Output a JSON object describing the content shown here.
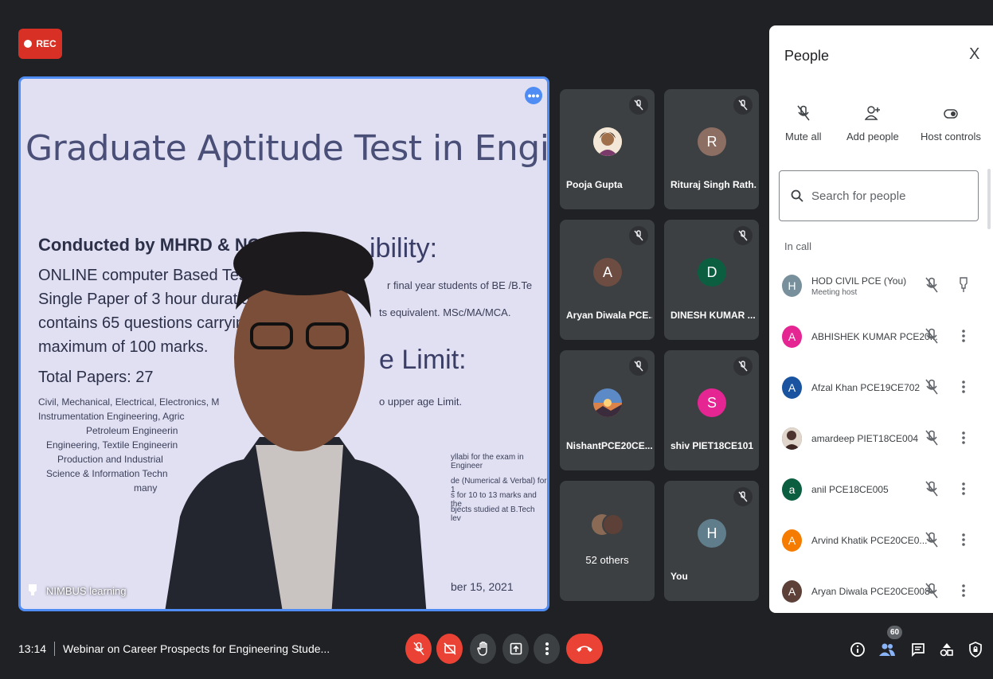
{
  "recording": {
    "label": "REC"
  },
  "slide": {
    "title": "Graduate Aptitude Test in Engineering",
    "heading": "Conducted by MHRD & NCB.",
    "lines": [
      "ONLINE computer Based Test (CBT)",
      "Single Paper of 3 hour duration that",
      "contains 65 questions carrying a",
      "maximum of 100 marks."
    ],
    "total_papers": "Total Papers: 27",
    "small_lines": [
      "Civil, Mechanical, Electrical, Electronics, M",
      "Instrumentation Engineering, Agric",
      "Petroleum Engineerin",
      "Engineering, Textile Engineerin",
      "Production and Industrial",
      "Science & Information Techn",
      "many"
    ],
    "right_heading_1": "ibility:",
    "right_text_1": "r final year students of BE /B.Te",
    "right_text_2": "ts equivalent. MSc/MA/MCA.",
    "right_heading_2": "e Limit:",
    "right_text_3": "o upper age Limit.",
    "right_small": [
      "yllabi for the exam in Engineer",
      "de (Numerical & Verbal) for 1",
      "s for 10 to 13 marks and the",
      "bjects studied at B.Tech lev"
    ],
    "date_fragment": "ber 15, 2021"
  },
  "main_tile": {
    "name": "NIMBUS learning",
    "more_glyph": "•••"
  },
  "tiles": [
    {
      "name": "Pooja Gupta",
      "initial": "",
      "color": "#f0c080"
    },
    {
      "name": "Rituraj Singh Rath...",
      "initial": "R",
      "color": "#8d6e63"
    },
    {
      "name": "Aryan Diwala PCE...",
      "initial": "A",
      "color": "#6d4c41"
    },
    {
      "name": "DINESH KUMAR ...",
      "initial": "D",
      "color": "#0b5e40"
    },
    {
      "name": "NishantPCE20CE...",
      "initial": "",
      "color": "#5c8ac7"
    },
    {
      "name": "shiv PIET18CE101",
      "initial": "S",
      "color": "#e52592"
    },
    {
      "name": "52 others",
      "initial": "",
      "color": ""
    },
    {
      "name": "You",
      "initial": "H",
      "color": "#607d8b"
    }
  ],
  "people": {
    "title": "People",
    "close": "X",
    "mute_all": "Mute all",
    "add_people": "Add people",
    "host_controls": "Host controls",
    "search_placeholder": "Search for people",
    "in_call": "In call",
    "participants": [
      {
        "name": "HOD CIVIL PCE (You)",
        "sub": "Meeting host",
        "initial": "H",
        "color": "#78909c"
      },
      {
        "name": "ABHISHEK KUMAR PCE20...",
        "sub": "",
        "initial": "A",
        "color": "#e52592"
      },
      {
        "name": "Afzal Khan PCE19CE702",
        "sub": "",
        "initial": "A",
        "color": "#1a53a0"
      },
      {
        "name": "amardeep PIET18CE004",
        "sub": "",
        "initial": "",
        "color": "#5d4037"
      },
      {
        "name": "anil PCE18CE005",
        "sub": "",
        "initial": "a",
        "color": "#0b5e40"
      },
      {
        "name": "Arvind Khatik PCE20CE0...",
        "sub": "",
        "initial": "A",
        "color": "#f57c00"
      },
      {
        "name": "Aryan Diwala PCE20CE008",
        "sub": "",
        "initial": "A",
        "color": "#5d4037"
      }
    ]
  },
  "bottom": {
    "time": "13:14",
    "meeting_title": "Webinar on Career Prospects for Engineering Stude...",
    "people_count": "60"
  },
  "colors": {
    "background": "#202124",
    "tile": "#3c4043",
    "accent": "#4f8cf3",
    "danger": "#ea4335"
  }
}
